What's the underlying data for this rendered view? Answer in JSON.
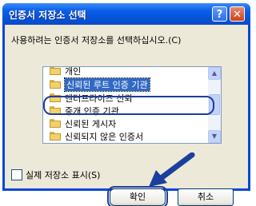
{
  "window": {
    "title": "인증서 저장소 선택"
  },
  "titlebar_buttons": {
    "help_glyph": "?",
    "close_glyph": "✕"
  },
  "prompt": "사용하려는 인증서 저장소를 선택하십시오.(C)",
  "stores": [
    {
      "label": "개인"
    },
    {
      "label": "신뢰된 루트 인증 기관",
      "selected": true
    },
    {
      "label": "엔터프라이즈 신뢰"
    },
    {
      "label": "중개 인증 기관"
    },
    {
      "label": "신뢰된 게시자"
    },
    {
      "label": "신뢰되지 않은 인증서"
    }
  ],
  "scrollbar": {
    "up_glyph": "▲",
    "down_glyph": "▼"
  },
  "show_physical": {
    "label": "실제 저장소 표시(S)",
    "checked": false
  },
  "buttons": {
    "ok": "확인",
    "cancel": "취소"
  },
  "colors": {
    "title_bar": "#0a5fe9",
    "selection": "#316ac5",
    "dialog_bg": "#ece9d8",
    "annotation": "#1b3f9c"
  }
}
